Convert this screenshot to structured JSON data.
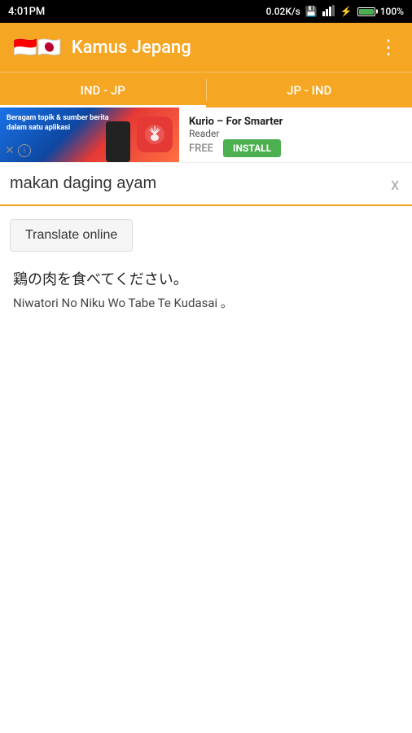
{
  "statusBar": {
    "time": "4:01PM",
    "network": "0.02K/s",
    "batteryPercent": "100%"
  },
  "appBar": {
    "title": "Kamus Jepang",
    "moreIcon": "⋮",
    "flags": "🇮🇩🇯🇵"
  },
  "tabs": [
    {
      "id": "ind-jp",
      "label": "IND - JP",
      "active": true
    },
    {
      "id": "jp-ind",
      "label": "JP - IND",
      "active": false
    }
  ],
  "ad": {
    "brand": "Kurio – For Smarter",
    "brandLine2": "Reader",
    "freeLabel": "FREE",
    "installLabel": "INSTALL",
    "adText": "Beragam topik & sumber berita\ndalam satu aplikasi"
  },
  "search": {
    "value": "makan daging ayam",
    "clearLabel": "x"
  },
  "translateButton": {
    "label": "Translate online"
  },
  "result": {
    "japanese": "鶏の肉を食べてください。",
    "romanji": "Niwatori No Niku Wo Tabe Te Kudasai 。"
  }
}
